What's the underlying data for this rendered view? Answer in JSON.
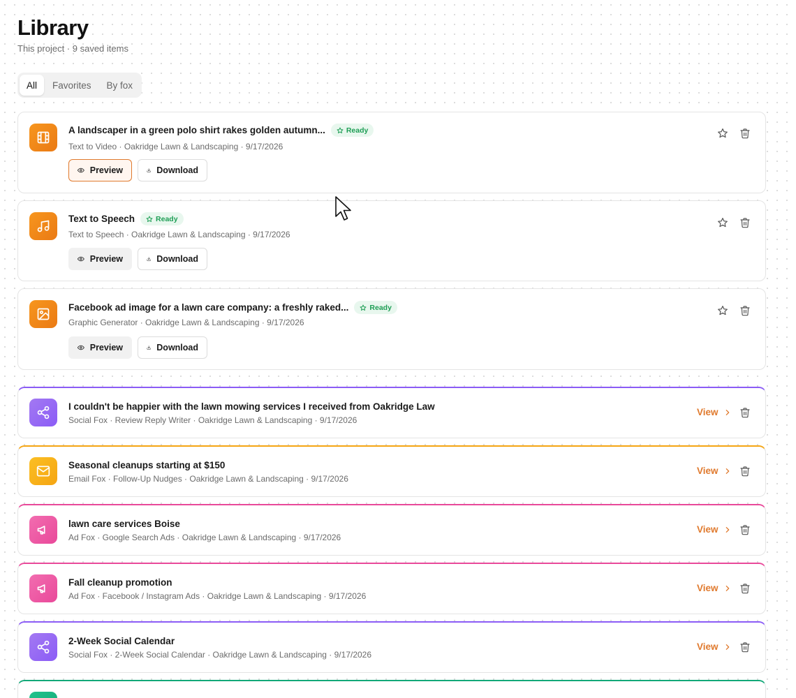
{
  "header": {
    "title": "Library",
    "subtitle": "This project · 9 saved items"
  },
  "tabs": [
    {
      "label": "All",
      "active": true
    },
    {
      "label": "Favorites",
      "active": false
    },
    {
      "label": "By fox",
      "active": false
    }
  ],
  "buttons": {
    "preview": "Preview",
    "download": "Download",
    "view": "View"
  },
  "media_items": [
    {
      "title": "A landscaper in a green polo shirt rakes golden autumn...",
      "status": "Ready",
      "meta": "Text to Video · Oakridge Lawn & Landscaping · 9/17/2026",
      "icon": "film-icon",
      "color": "#f08a1a"
    },
    {
      "title": "Text to Speech",
      "status": "Ready",
      "meta": "Text to Speech · Oakridge Lawn & Landscaping · 9/17/2026",
      "icon": "music-note-icon",
      "color": "#f08a1a"
    },
    {
      "title": "Facebook ad image for a lawn care company: a freshly raked...",
      "status": "Ready",
      "meta": "Graphic Generator · Oakridge Lawn & Landscaping · 9/17/2026",
      "icon": "image-icon",
      "color": "#f08a1a"
    }
  ],
  "text_items": [
    {
      "title": "I couldn't be happier with the lawn mowing services I received from Oakridge Law",
      "meta": "Social Fox · Review Reply Writer · Oakridge Lawn & Landscaping · 9/17/2026",
      "icon": "share-icon",
      "color": "#8b5cf6"
    },
    {
      "title": "Seasonal cleanups starting at $150",
      "meta": "Email Fox · Follow-Up Nudges · Oakridge Lawn & Landscaping · 9/17/2026",
      "icon": "mail-icon",
      "color": "#f5a512"
    },
    {
      "title": "lawn care services Boise",
      "meta": "Ad Fox · Google Search Ads · Oakridge Lawn & Landscaping · 9/17/2026",
      "icon": "megaphone-icon",
      "color": "#e9499a"
    },
    {
      "title": "Fall cleanup promotion",
      "meta": "Ad Fox · Facebook / Instagram Ads · Oakridge Lawn & Landscaping · 9/17/2026",
      "icon": "megaphone-icon",
      "color": "#e9499a"
    },
    {
      "title": "2-Week Social Calendar",
      "meta": "Social Fox · 2-Week Social Calendar · Oakridge Lawn & Landscaping · 9/17/2026",
      "icon": "share-icon",
      "color": "#8b5cf6"
    },
    {
      "title": "",
      "meta": "",
      "icon": "",
      "color": "#12a878"
    }
  ]
}
